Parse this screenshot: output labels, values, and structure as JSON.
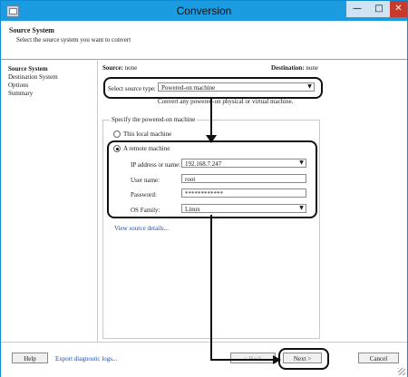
{
  "window": {
    "title": "Conversion"
  },
  "header": {
    "title": "Source System",
    "subtitle": "Select the source system you want to convert"
  },
  "nav": {
    "items": [
      "Source System",
      "Destination System",
      "Options",
      "Summary"
    ]
  },
  "summary": {
    "source_label": "Source:",
    "source_value": "none",
    "destination_label": "Destination:",
    "destination_value": "none"
  },
  "source_type": {
    "label": "Select source type:",
    "value": "Powered-on machine",
    "hint": "Convert any powered-on physical or virtual machine."
  },
  "powered_on": {
    "legend": "Specify the powered-on machine",
    "local_option": "This local machine",
    "remote_option": "A remote machine",
    "selected": "remote"
  },
  "remote": {
    "ip_label": "IP address or name:",
    "ip_value": "192.168.7.247",
    "user_label": "User name:",
    "user_value": "root",
    "password_label": "Password:",
    "password_value": "************",
    "os_label": "OS Family:",
    "os_value": "Linux"
  },
  "details_link": "View source details...",
  "footer": {
    "help": "Help",
    "export": "Export diagnostic logs...",
    "back": "< Back",
    "next": "Next >",
    "cancel": "Cancel"
  },
  "colors": {
    "titlebar": "#1b9be0",
    "close": "#c7392c",
    "link": "#1a4fb6",
    "highlight": "#111111"
  },
  "icons": {
    "window_icon": "app-window-icon",
    "minimize": "minimize-icon",
    "maximize": "maximize-icon",
    "close": "close-icon",
    "dropdown": "chevron-down-icon"
  }
}
